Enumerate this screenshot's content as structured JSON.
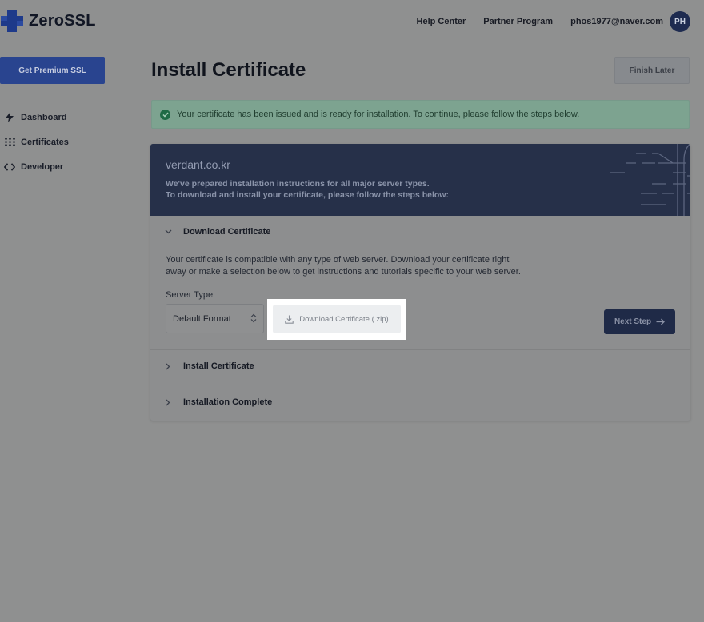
{
  "brand": {
    "name": "ZeroSSL",
    "logo_color": "#1e3a8a"
  },
  "topnav": {
    "help": "Help Center",
    "partner": "Partner Program",
    "email": "phos1977@naver.com",
    "avatar_initials": "PH"
  },
  "sidebar": {
    "premium_button": "Get Premium SSL",
    "items": [
      {
        "label": "Dashboard",
        "icon": "bolt-icon"
      },
      {
        "label": "Certificates",
        "icon": "grid-dots-icon"
      },
      {
        "label": "Developer",
        "icon": "code-brackets-icon"
      }
    ]
  },
  "main": {
    "title": "Install Certificate",
    "finish_later": "Finish Later",
    "alert": "Your certificate has been issued and is ready for installation. To continue, please follow the steps below."
  },
  "card": {
    "domain": "verdant.co.kr",
    "line1": "We've prepared installation instructions for all major server types.",
    "line2": "To download and install your certificate, please follow the steps below:",
    "steps": [
      {
        "title": "Download Certificate",
        "expanded": true
      },
      {
        "title": "Install Certificate",
        "expanded": false
      },
      {
        "title": "Installation Complete",
        "expanded": false
      }
    ],
    "description_line1": "Your certificate is compatible with any type of web server. Download your certificate right",
    "description_line2": "away or make a selection below to get instructions and tutorials specific to your web server.",
    "server_type_label": "Server Type",
    "server_type_value": "Default Format",
    "download_button": "Download Certificate (.zip)",
    "next_step": "Next Step"
  }
}
